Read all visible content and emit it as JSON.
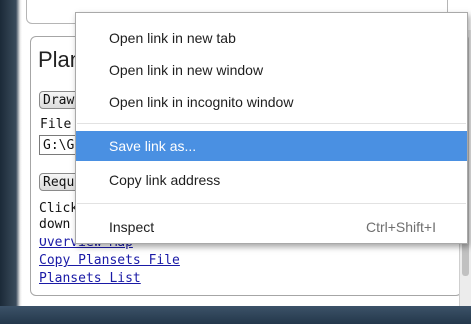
{
  "page": {
    "panel_title": "Planset",
    "draw_button": "Draw Plansets",
    "file_label": "File Location",
    "file_path": "G:\\Grain\\",
    "request_button": "Request",
    "click_text_1": "Click",
    "click_text_2": "down",
    "links": [
      "Overview Map",
      "Copy Plansets File",
      "Plansets List"
    ]
  },
  "context_menu": {
    "items": [
      {
        "label": "Open link in new tab",
        "shortcut": ""
      },
      {
        "label": "Open link in new window",
        "shortcut": ""
      },
      {
        "label": "Open link in incognito window",
        "shortcut": ""
      },
      {
        "label": "Save link as...",
        "shortcut": "",
        "highlighted": true
      },
      {
        "label": "Copy link address",
        "shortcut": ""
      },
      {
        "label": "Inspect",
        "shortcut": "Ctrl+Shift+I"
      }
    ]
  },
  "colors": {
    "highlight": "#4a90e2",
    "link": "#1a1aa6",
    "frame": "#2b3f52"
  }
}
